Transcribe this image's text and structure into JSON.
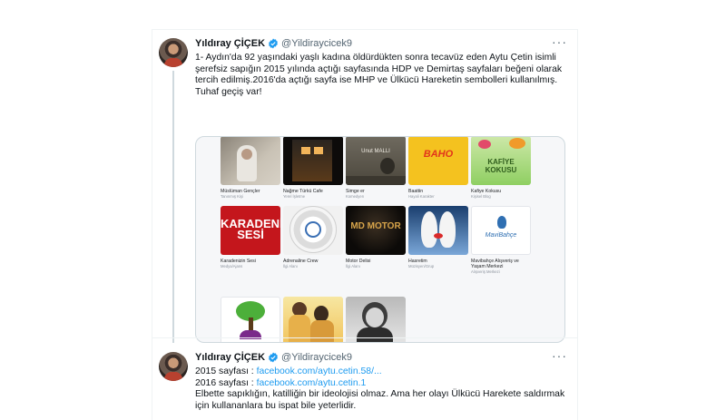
{
  "tweets": [
    {
      "name": "Yıldıray ÇİÇEK",
      "handle": "@Yildiraycicek9",
      "text": "1- Aydın'da 92 yaşındaki yaşlı kadına öldürdükten sonra tecavüz eden Aytu Çetin isimli şerefsiz sapığın 2015 yılında açtığı sayfasında HDP ve Demirtaş sayfaları beğeni olarak tercih edilmiş.2016'da açtığı sayfa ise MHP ve Ülkücü Hareketin sembolleri kullanılmış. Tuhaf geçiş var!"
    },
    {
      "name": "Yıldıray ÇİÇEK",
      "handle": "@Yildiraycicek9",
      "line1_prefix": "2015 sayfası : ",
      "line1_link": "facebook.com/aytu.cetin.58/...",
      "line2_prefix": "2016 sayfası : ",
      "line2_link": "facebook.com/aytu.cetin.1",
      "text": "Elbette sapıklığın, katilliğin bir ideolojisi olmaz. Ama her olayı Ülkücü Harekete saldırmak için kullananlara bu ispat bile yeterlidir."
    }
  ],
  "more_glyph": "···",
  "pages": [
    {
      "title": "Müslüman Gençler",
      "category": "Tanınmış Kişi",
      "thumb_text": ""
    },
    {
      "title": "Nağme Türkü Cafe",
      "category": "Yerel İşletme",
      "thumb_text": ""
    },
    {
      "title": "Simge er",
      "category": "Komedyen",
      "thumb_text": "Unut MALLI"
    },
    {
      "title": "Baattin",
      "category": "Hayali Karakter",
      "thumb_text": "BAHO"
    },
    {
      "title": "Kafiye Kokusu",
      "category": "Kişisel Blog",
      "thumb_text": "KAFİYE KOKUSU"
    },
    {
      "title": "Karadenizin Sesi",
      "category": "Medya/Ajans",
      "thumb_text": "KARADENİZİN SESİ"
    },
    {
      "title": "Adrenaline Crew",
      "category": "İlgi Alanı",
      "thumb_text": ""
    },
    {
      "title": "Motor Delisi",
      "category": "İlgi Alanı",
      "thumb_text": "MD MOTOR"
    },
    {
      "title": "Hasretim",
      "category": "Müzisyen/Grup",
      "thumb_text": ""
    },
    {
      "title": "Mavibahçe Alışveriş ve Yaşam Merkezi",
      "category": "Alışveriş Merkezi",
      "thumb_text": "MaviBahçe"
    },
    {
      "title": "",
      "category": "",
      "thumb_text": ""
    },
    {
      "title": "",
      "category": "",
      "thumb_text": ""
    },
    {
      "title": "",
      "category": "",
      "thumb_text": ""
    }
  ],
  "colors": {
    "link": "#1d9bf0",
    "verified": "#1d9bf0",
    "handle": "#536471"
  }
}
